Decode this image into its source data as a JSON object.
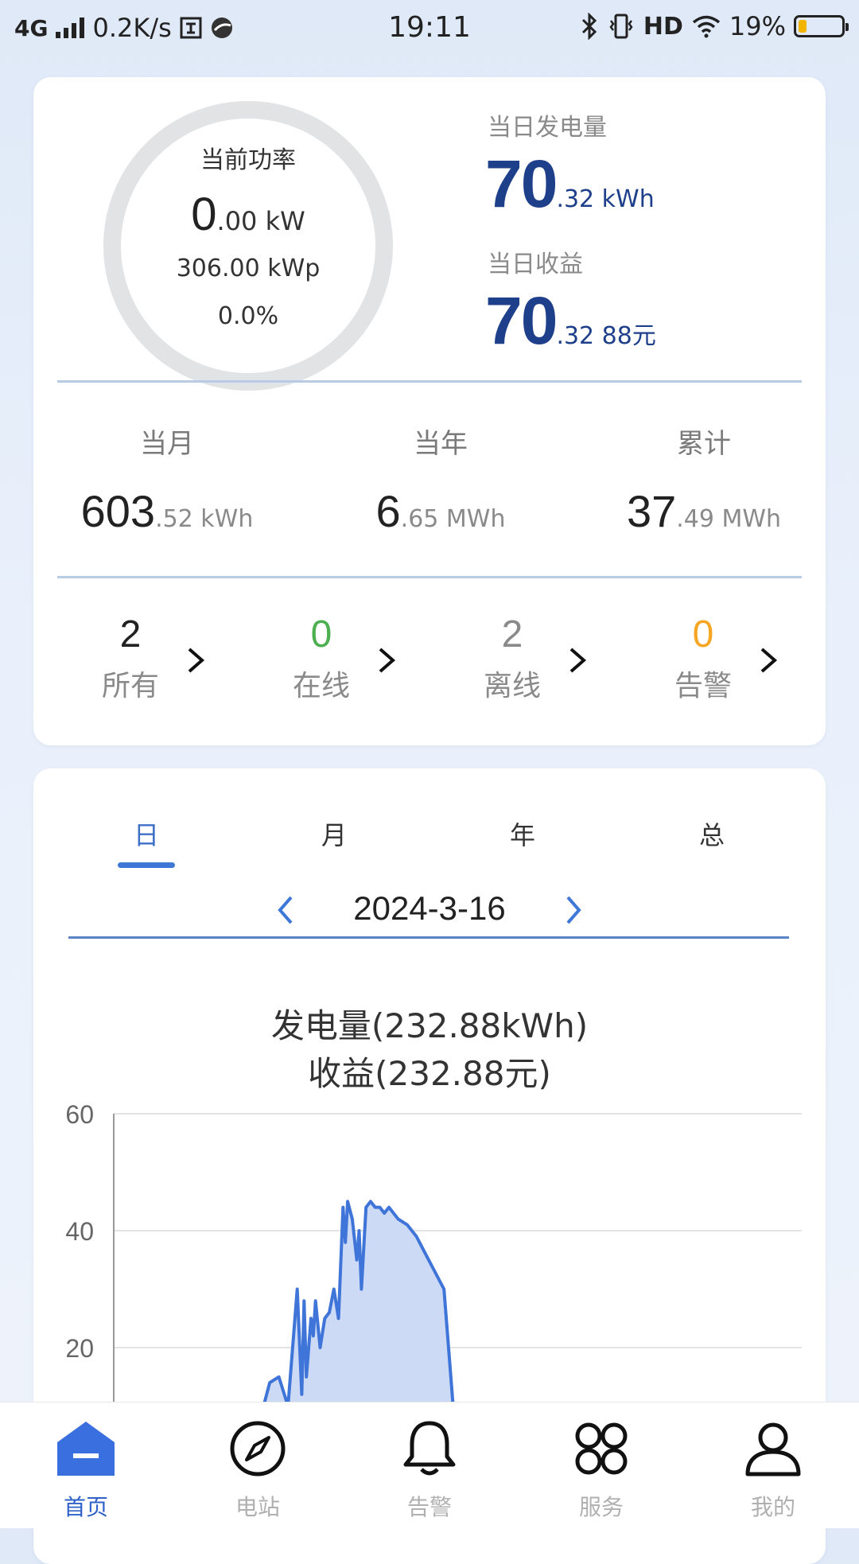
{
  "status_bar": {
    "network": "4G",
    "speed": "0.2K/s",
    "time": "19:11",
    "hd": "HD",
    "battery_percent": "19%",
    "battery_level": 0.19
  },
  "power_card": {
    "ring_title": "当前功率",
    "current_power_int": "0",
    "current_power_dec": ".00 kW",
    "capacity": "306.00 kWp",
    "ratio": "0.0%",
    "daily_gen_label": "当日发电量",
    "daily_gen_int": "70",
    "daily_gen_dec": ".32 kWh",
    "daily_income_label": "当日收益",
    "daily_income_int": "70",
    "daily_income_dec": ".32 88元"
  },
  "totals": {
    "month_label": "当月",
    "month_int": "603",
    "month_dec": ".52 kWh",
    "year_label": "当年",
    "year_int": "6",
    "year_dec": ".65 MWh",
    "total_label": "累计",
    "total_int": "37",
    "total_dec": ".49 MWh"
  },
  "devices": {
    "all_count": "2",
    "all_label": "所有",
    "online_count": "0",
    "online_label": "在线",
    "offline_count": "2",
    "offline_label": "离线",
    "alarm_count": "0",
    "alarm_label": "告警"
  },
  "period_tabs": {
    "day": "日",
    "month": "月",
    "year": "年",
    "total": "总"
  },
  "date_nav": {
    "date": "2024-3-16"
  },
  "chart_title": {
    "line1": "发电量(232.88kWh)",
    "line2": "收益(232.88元)"
  },
  "colors": {
    "accent": "#3d6fc6",
    "dark_num": "#1e3f8a",
    "online": "#4caf50",
    "alarm": "#f5a623",
    "line": "#3f74d8",
    "area": "#cddaf5"
  },
  "chart_data": {
    "type": "area",
    "title": "",
    "xlabel": "",
    "ylabel": "",
    "ylim": [
      0,
      60
    ],
    "yticks": [
      "60",
      "40",
      "20"
    ],
    "x_hours": [
      10.0,
      10.2,
      10.4,
      10.6,
      10.8,
      11.0,
      11.1,
      11.15,
      11.2,
      11.3,
      11.35,
      11.4,
      11.5,
      11.6,
      11.7,
      11.8,
      11.9,
      12.0,
      12.05,
      12.1,
      12.2,
      12.3,
      12.35,
      12.4,
      12.5,
      12.6,
      12.7,
      12.8,
      12.9,
      13.0,
      13.2,
      13.4,
      13.6,
      13.8,
      14.0,
      14.2,
      14.4,
      14.55,
      14.6,
      14.8,
      15.0,
      15.2,
      15.4
    ],
    "values": [
      0,
      8,
      14,
      15,
      10,
      30,
      12,
      28,
      15,
      25,
      22,
      28,
      20,
      25,
      26,
      30,
      25,
      44,
      38,
      45,
      42,
      35,
      40,
      30,
      44,
      45,
      44,
      44,
      43,
      44,
      42,
      41,
      39,
      36,
      33,
      30,
      10,
      0,
      0,
      2,
      0,
      7,
      0
    ]
  },
  "bottom_nav": {
    "home": "首页",
    "station": "电站",
    "alarm": "告警",
    "service": "服务",
    "mine": "我的"
  }
}
